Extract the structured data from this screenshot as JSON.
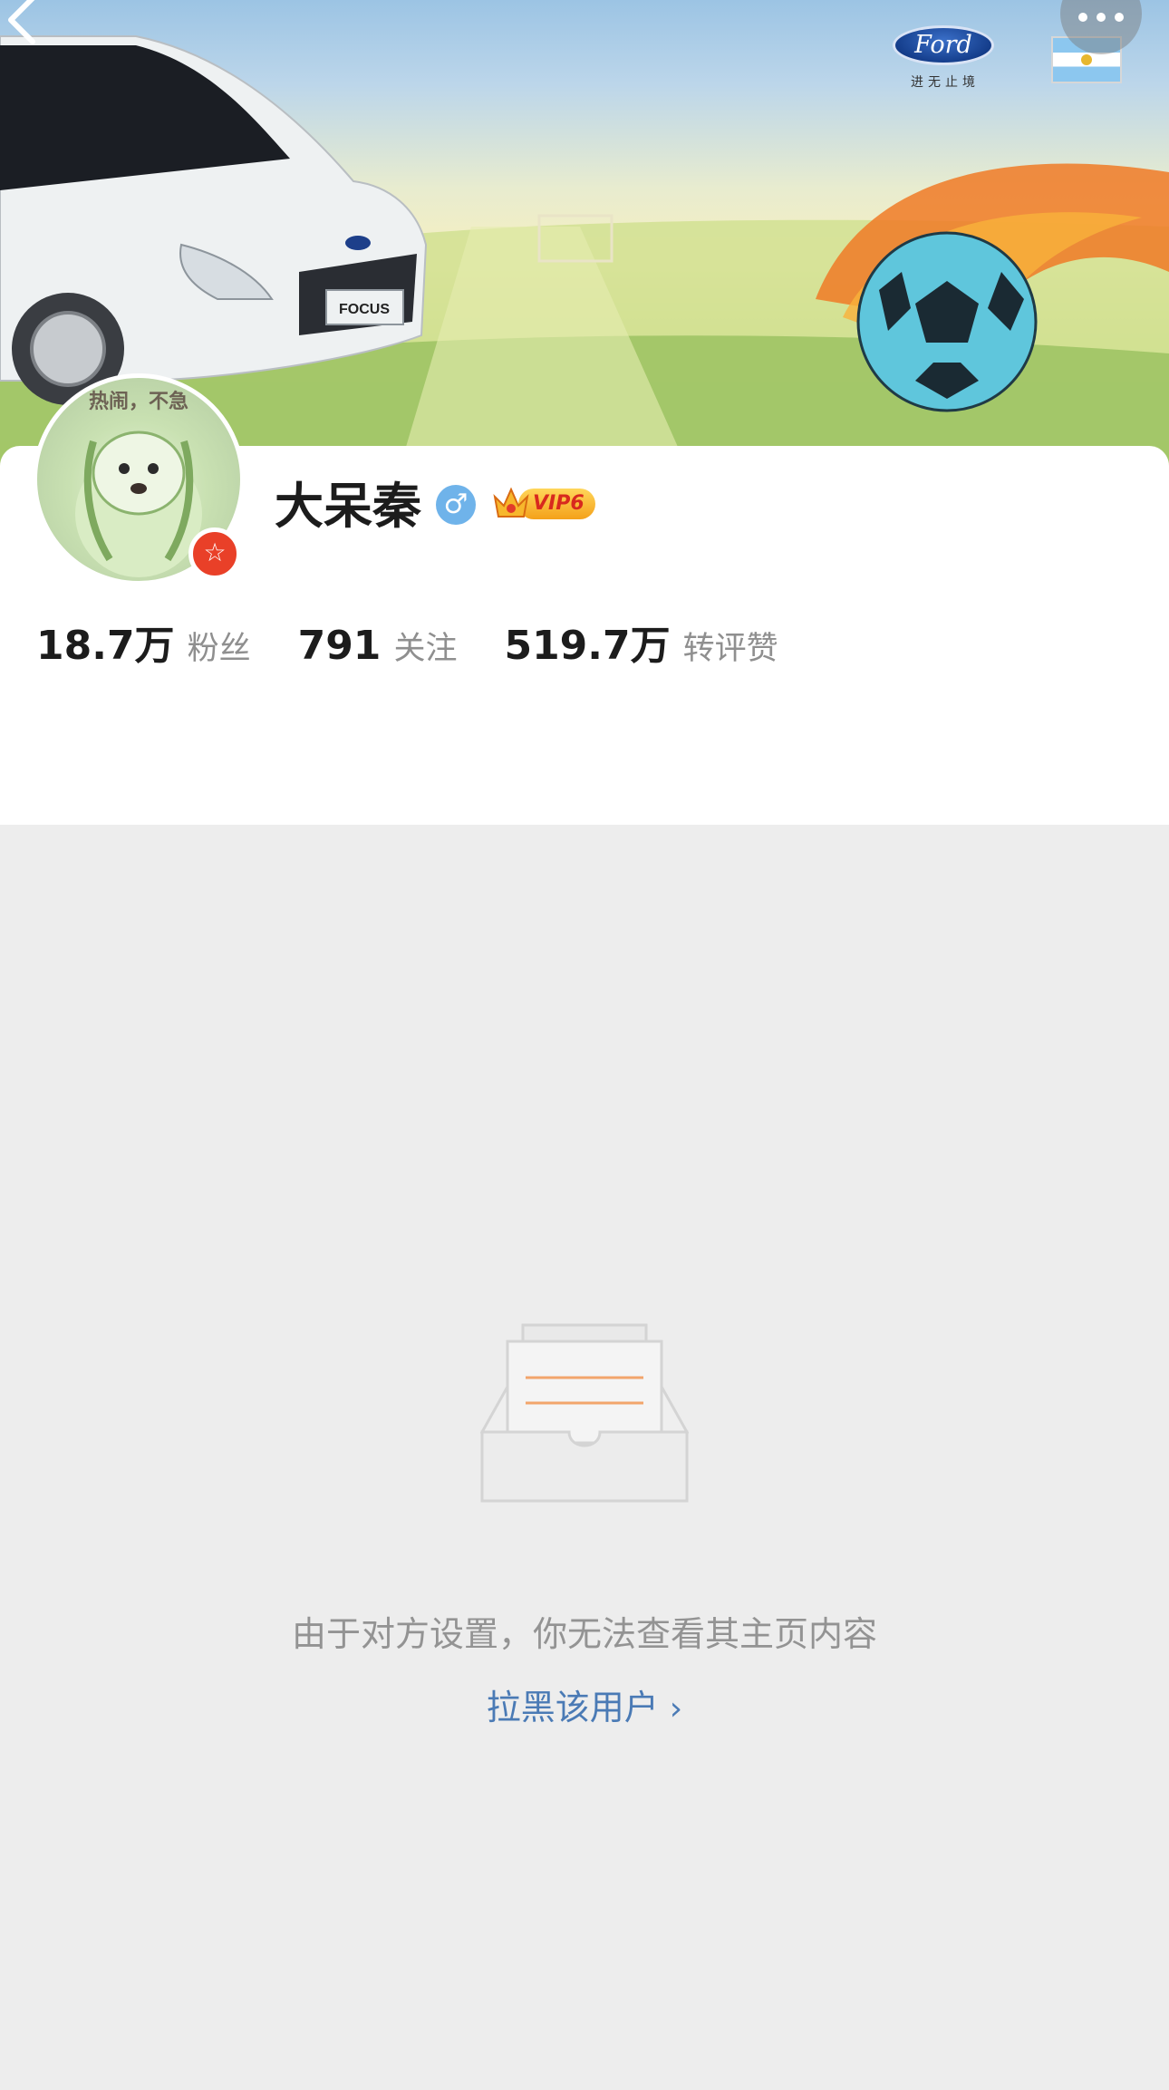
{
  "banner": {
    "brand_logo_text": "Ford",
    "brand_tagline": "进无止境",
    "car_plate_text": "FOCUS",
    "flag": "argentina-flag"
  },
  "nav": {
    "back_icon": "chevron-left-icon",
    "more_icon": "more-dots-icon"
  },
  "profile": {
    "avatar_caption": "热闹，不急",
    "name": "大呆秦",
    "gender_symbol": "♂",
    "vip_label": "VIP6",
    "badge_icon": "star-badge-icon",
    "stats": [
      {
        "value": "18.7万",
        "label": "粉丝"
      },
      {
        "value": "791",
        "label": "关注"
      },
      {
        "value": "519.7万",
        "label": "转评赞"
      }
    ]
  },
  "empty_state": {
    "illustration": "empty-inbox-icon",
    "message": "由于对方设置，你无法查看其主页内容",
    "action_label": "拉黑该用户",
    "action_chevron": "›"
  },
  "colors": {
    "page_bg": "#ededed",
    "card_bg": "#ffffff",
    "link": "#4a7ab5",
    "muted_text": "#939393",
    "badge_red": "#e94028",
    "gender_blue": "#6fb3ea",
    "vip_gold": "#f4a11a"
  }
}
